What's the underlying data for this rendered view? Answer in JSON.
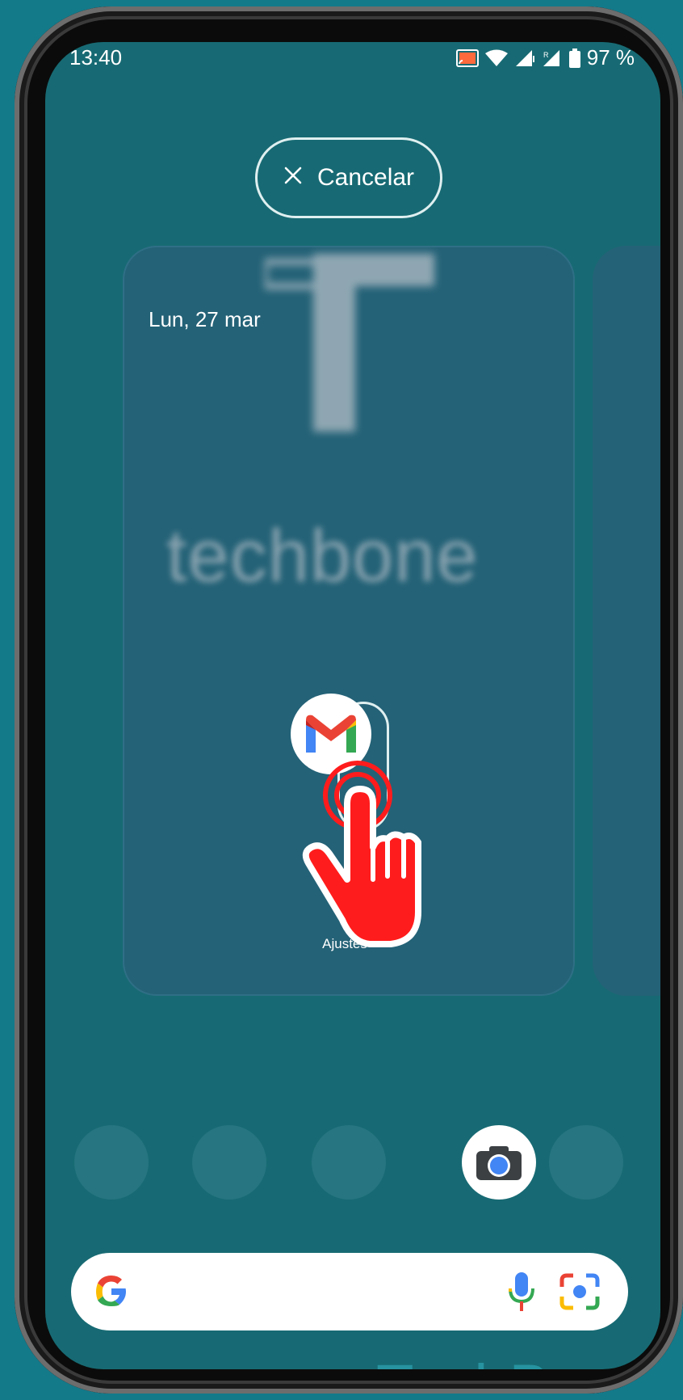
{
  "status_bar": {
    "time": "13:40",
    "battery_percent": "97 %",
    "icons": [
      "cast-icon",
      "wifi-icon",
      "signal-icon",
      "signal-roaming-icon",
      "battery-icon"
    ]
  },
  "cancel_button": {
    "label": "Cancelar",
    "icon": "close-icon"
  },
  "widget": {
    "date": "Lun, 27 mar"
  },
  "watermark": {
    "brand": "techbone",
    "letter": "T",
    "corner_brand": "TechBone"
  },
  "drag": {
    "dragged_app_icon": "gmail-icon",
    "dropped_app_label": "Ajustes",
    "gesture_icon": "hand-pointer-icon"
  },
  "dock": {
    "apps": [
      "empty",
      "empty",
      "empty",
      "camera",
      "empty"
    ]
  },
  "search": {
    "logo": "google-g-icon",
    "mic_icon": "mic-icon",
    "lens_icon": "lens-icon"
  },
  "colors": {
    "background": "#137a8a",
    "screen": "#176a73",
    "card": "#246277",
    "accent_red": "#ff1c1c"
  }
}
